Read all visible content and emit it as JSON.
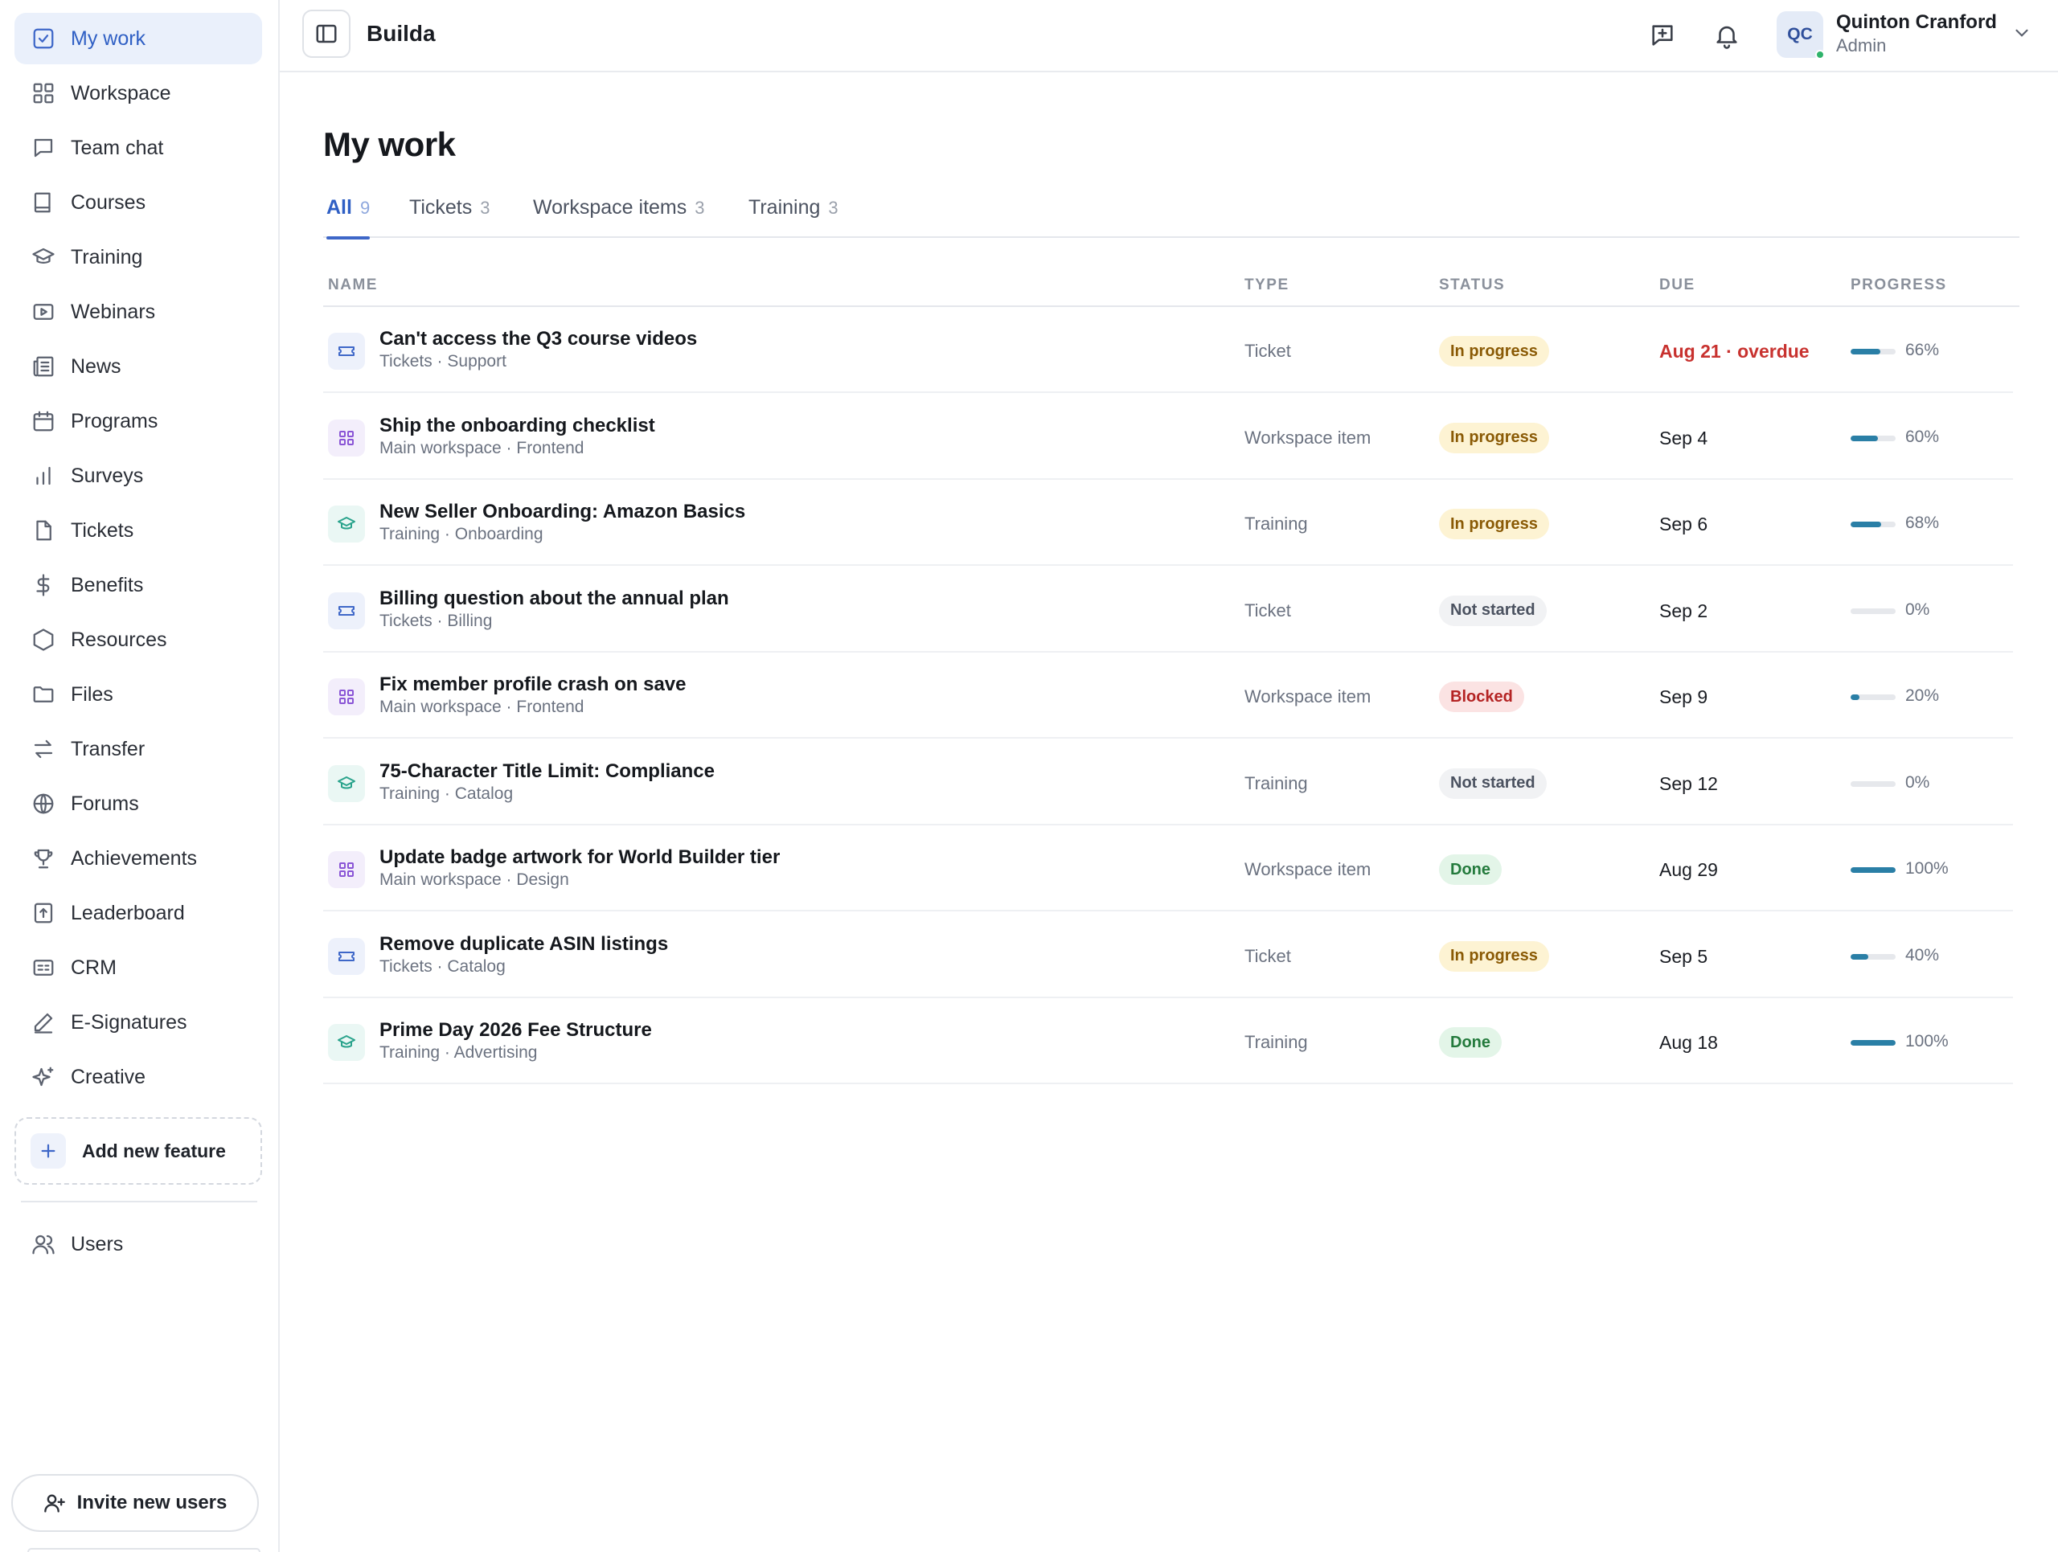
{
  "sidebar": {
    "items": [
      {
        "label": "My work",
        "icon": "checkbox-icon",
        "active": true
      },
      {
        "label": "Workspace",
        "icon": "grid-icon"
      },
      {
        "label": "Team chat",
        "icon": "chat-icon"
      },
      {
        "label": "Courses",
        "icon": "book-icon"
      },
      {
        "label": "Training",
        "icon": "graduation-cap-icon"
      },
      {
        "label": "Webinars",
        "icon": "play-icon"
      },
      {
        "label": "News",
        "icon": "newspaper-icon"
      },
      {
        "label": "Programs",
        "icon": "calendar-icon"
      },
      {
        "label": "Surveys",
        "icon": "bar-chart-icon"
      },
      {
        "label": "Tickets",
        "icon": "file-icon"
      },
      {
        "label": "Benefits",
        "icon": "dollar-icon"
      },
      {
        "label": "Resources",
        "icon": "hexagon-icon"
      },
      {
        "label": "Files",
        "icon": "folder-icon"
      },
      {
        "label": "Transfer",
        "icon": "transfer-icon"
      },
      {
        "label": "Forums",
        "icon": "globe-icon"
      },
      {
        "label": "Achievements",
        "icon": "trophy-icon"
      },
      {
        "label": "Leaderboard",
        "icon": "leaderboard-icon"
      },
      {
        "label": "CRM",
        "icon": "id-card-icon"
      },
      {
        "label": "E-Signatures",
        "icon": "pen-icon"
      },
      {
        "label": "Creative",
        "icon": "sparkles-icon"
      }
    ],
    "add_feature_label": "Add new feature",
    "users_label": "Users",
    "invite_label": "Invite new users"
  },
  "header": {
    "app_name": "Builda",
    "user": {
      "initials": "QC",
      "name": "Quinton Cranford",
      "role": "Admin"
    }
  },
  "main": {
    "title": "My work",
    "tabs": [
      {
        "label": "All",
        "count": "9",
        "active": true
      },
      {
        "label": "Tickets",
        "count": "3"
      },
      {
        "label": "Workspace items",
        "count": "3"
      },
      {
        "label": "Training",
        "count": "3"
      }
    ],
    "columns": {
      "name": "NAME",
      "type": "TYPE",
      "status": "STATUS",
      "due": "DUE",
      "progress": "PROGRESS"
    },
    "rows": [
      {
        "kind": "ticket",
        "name": "Can't access the Q3 course videos",
        "sub": "Tickets · Support",
        "type": "Ticket",
        "status": "In progress",
        "status_kind": "in-progress",
        "due": "Aug 21 · overdue",
        "overdue": true,
        "progress": 66,
        "progress_label": "66%"
      },
      {
        "kind": "workspace",
        "name": "Ship the onboarding checklist",
        "sub": "Main workspace · Frontend",
        "type": "Workspace item",
        "status": "In progress",
        "status_kind": "in-progress",
        "due": "Sep 4",
        "progress": 60,
        "progress_label": "60%"
      },
      {
        "kind": "training",
        "name": "New Seller Onboarding: Amazon Basics",
        "sub": "Training · Onboarding",
        "type": "Training",
        "status": "In progress",
        "status_kind": "in-progress",
        "due": "Sep 6",
        "progress": 68,
        "progress_label": "68%"
      },
      {
        "kind": "ticket",
        "name": "Billing question about the annual plan",
        "sub": "Tickets · Billing",
        "type": "Ticket",
        "status": "Not started",
        "status_kind": "not-started",
        "due": "Sep 2",
        "progress": 0,
        "progress_label": "0%"
      },
      {
        "kind": "workspace",
        "name": "Fix member profile crash on save",
        "sub": "Main workspace · Frontend",
        "type": "Workspace item",
        "status": "Blocked",
        "status_kind": "blocked",
        "due": "Sep 9",
        "progress": 20,
        "progress_label": "20%"
      },
      {
        "kind": "training",
        "name": "75-Character Title Limit: Compliance",
        "sub": "Training · Catalog",
        "type": "Training",
        "status": "Not started",
        "status_kind": "not-started",
        "due": "Sep 12",
        "progress": 0,
        "progress_label": "0%"
      },
      {
        "kind": "workspace",
        "name": "Update badge artwork for World Builder tier",
        "sub": "Main workspace · Design",
        "type": "Workspace item",
        "status": "Done",
        "status_kind": "done",
        "due": "Aug 29",
        "progress": 100,
        "progress_label": "100%"
      },
      {
        "kind": "ticket",
        "name": "Remove duplicate ASIN listings",
        "sub": "Tickets · Catalog",
        "type": "Ticket",
        "status": "In progress",
        "status_kind": "in-progress",
        "due": "Sep 5",
        "progress": 40,
        "progress_label": "40%"
      },
      {
        "kind": "training",
        "name": "Prime Day 2026 Fee Structure",
        "sub": "Training · Advertising",
        "type": "Training",
        "status": "Done",
        "status_kind": "done",
        "due": "Aug 18",
        "progress": 100,
        "progress_label": "100%"
      }
    ]
  },
  "colors": {
    "accent": "#3e67c8",
    "progress": "#2a7fa6",
    "overdue": "#c8322f"
  }
}
